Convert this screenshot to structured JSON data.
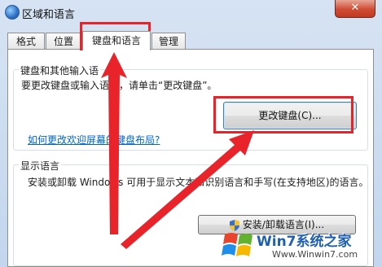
{
  "window": {
    "title": "区域和语言",
    "close_glyph": "✕"
  },
  "tabs": [
    {
      "label": "格式",
      "active": false
    },
    {
      "label": "位置",
      "active": false
    },
    {
      "label": "键盘和语言",
      "active": true
    },
    {
      "label": "管理",
      "active": false
    }
  ],
  "keyboard_group": {
    "title": "键盘和其他输入语",
    "description": "要更改键盘或输入语言，请单击“更改键盘”。",
    "change_button": "更改键盘(C)...",
    "help_link": "如何更改欢迎屏幕的键盘布局?"
  },
  "display_group": {
    "title": "显示语言",
    "description": "安装或卸载 Windows 可用于显示文本和识别语言和手写(在支持地区)的语言。",
    "install_button": "安装/卸载语言(I)..."
  },
  "watermark": {
    "title": "Win7系统之家",
    "url": "Www.Winwin7.com"
  },
  "colors": {
    "annotation": "#e8232a",
    "link": "#0066cc",
    "window_frame": "#c3d6ee"
  }
}
